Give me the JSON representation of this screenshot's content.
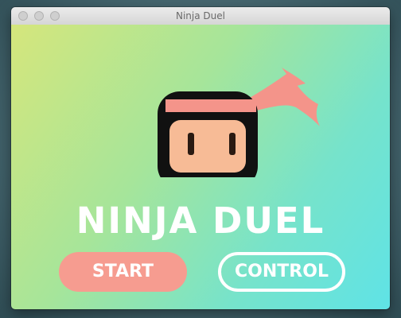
{
  "window": {
    "title": "Ninja Duel"
  },
  "game": {
    "title": "NINJA DUEL"
  },
  "menu": {
    "start_label": "START",
    "control_label": "CONTROL"
  },
  "icons": {
    "traffic_lights": [
      "close-light",
      "minimize-light",
      "zoom-light"
    ],
    "logo": "ninja-head-icon"
  },
  "colors": {
    "background_gradient": [
      "#d5e67c",
      "#a6e59a",
      "#76e3cb",
      "#5fe3e6"
    ],
    "headband": "#f4948a",
    "ninja_face": "#f7bb96",
    "ninja_mask": "#111111",
    "start_button": "#f69c90",
    "text": "#ffffff"
  }
}
